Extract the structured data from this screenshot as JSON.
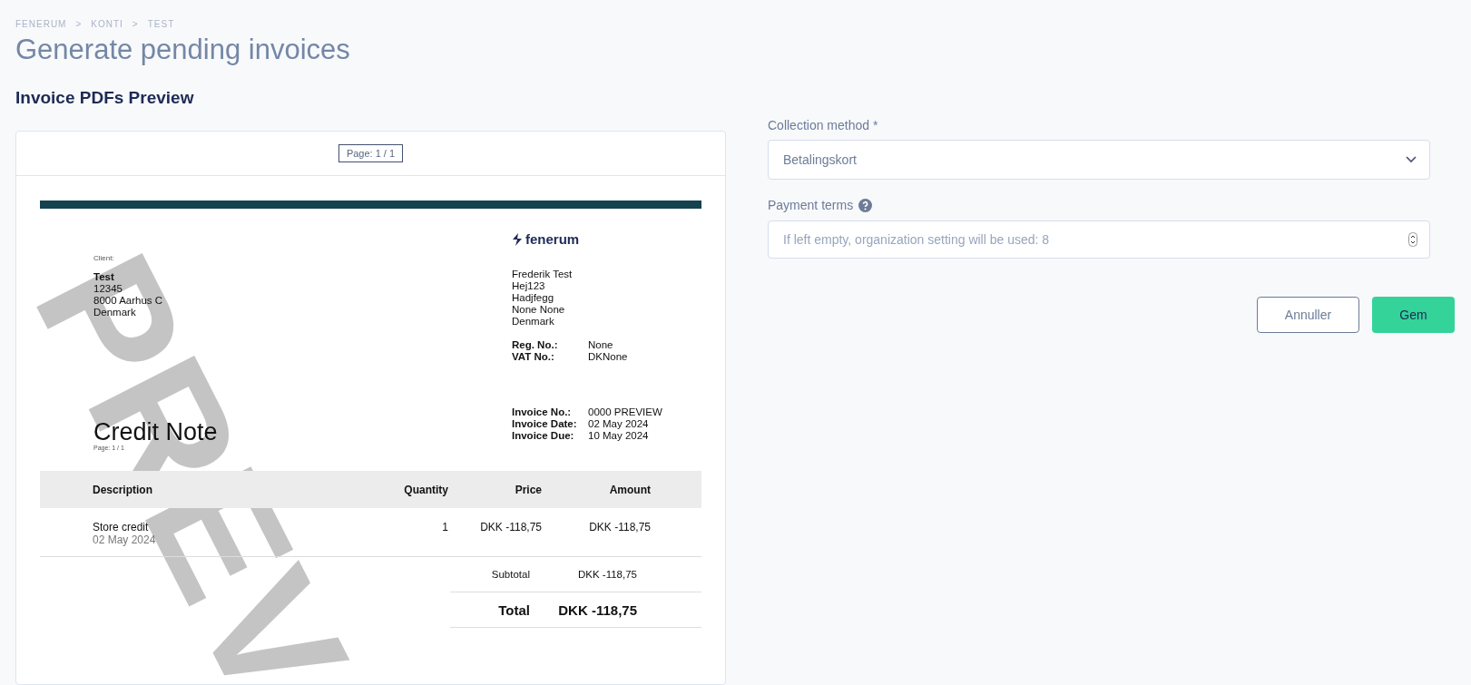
{
  "breadcrumb": {
    "items": [
      "FENERUM",
      "KONTI",
      "TEST"
    ],
    "separator": ">"
  },
  "title": "Generate pending invoices",
  "preview": {
    "heading": "Invoice PDFs Preview",
    "page_indicator": "Page: 1 / 1",
    "document": {
      "watermark": "PREV",
      "logo": "fenerum",
      "client_label": "Client:",
      "client_name": "Test",
      "client_lines": [
        "12345",
        "8000 Aarhus C",
        "Denmark"
      ],
      "sender_lines": [
        "Frederik Test",
        "Hej123",
        "Hadjfegg",
        "None None",
        "Denmark"
      ],
      "registration": [
        {
          "label": "Reg. No.:",
          "value": "None"
        },
        {
          "label": "VAT No.:",
          "value": "DKNone"
        }
      ],
      "doc_title": "Credit Note",
      "doc_page": "Page: 1 / 1",
      "invoice_info": [
        {
          "label": "Invoice No.:",
          "value": "0000 PREVIEW"
        },
        {
          "label": "Invoice Date:",
          "value": "02 May 2024"
        },
        {
          "label": "Invoice Due:",
          "value": "10 May 2024"
        }
      ],
      "columns": [
        "Description",
        "Quantity",
        "Price",
        "Amount"
      ],
      "rows": [
        {
          "description": "Store credit",
          "date": "02 May 2024",
          "quantity": "1",
          "price": "DKK -118,75",
          "amount": "DKK -118,75"
        }
      ],
      "subtotal": {
        "label": "Subtotal",
        "value": "DKK -118,75"
      },
      "total": {
        "label": "Total",
        "value": "DKK -118,75"
      }
    }
  },
  "form": {
    "collection_method": {
      "label": "Collection method *",
      "value": "Betalingskort"
    },
    "payment_terms": {
      "label": "Payment terms",
      "placeholder": "If left empty, organization setting will be used: 8"
    },
    "buttons": [
      {
        "label": "Annuller",
        "kind": "secondary"
      },
      {
        "label": "Gem",
        "kind": "primary"
      }
    ]
  }
}
